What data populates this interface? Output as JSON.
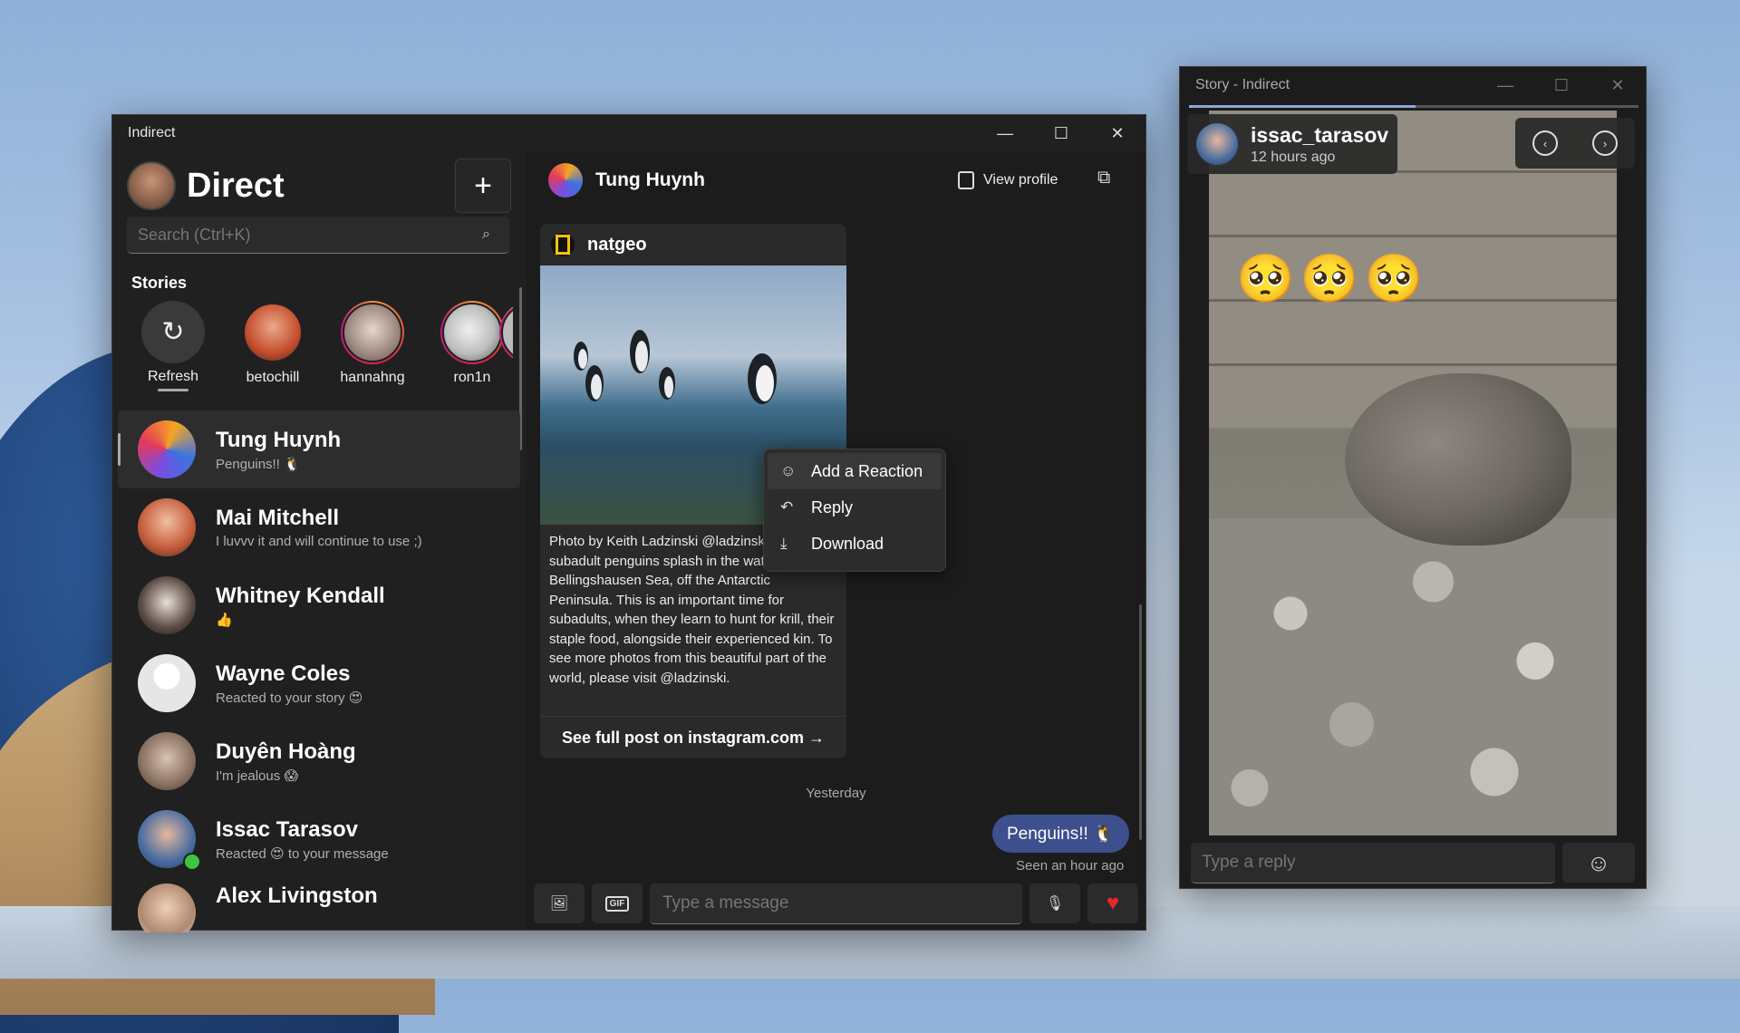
{
  "main_window": {
    "title": "Indirect",
    "minimize": "—",
    "maximize": "☐",
    "close": "✕"
  },
  "sidebar": {
    "title": "Direct",
    "new_button": "+",
    "search_placeholder": "Search (Ctrl+K)",
    "stories_label": "Stories",
    "stories": [
      {
        "name": "Refresh"
      },
      {
        "name": "betochill"
      },
      {
        "name": "hannahng"
      },
      {
        "name": "ron1n"
      }
    ],
    "conversations": [
      {
        "name": "Tung Huynh",
        "preview": "Penguins!! 🐧"
      },
      {
        "name": "Mai Mitchell",
        "preview": "I luvvv it and will continue to use ;)"
      },
      {
        "name": "Whitney Kendall",
        "preview": "👍"
      },
      {
        "name": "Wayne Coles",
        "preview": "Reacted to your story 😍"
      },
      {
        "name": "Duyên Hoàng",
        "preview": "I'm jealous 😱"
      },
      {
        "name": "Issac Tarasov",
        "preview": "Reacted 😍 to your message"
      },
      {
        "name": "Alex Livingston",
        "preview": ""
      }
    ]
  },
  "chat": {
    "contact_name": "Tung Huynh",
    "view_profile": "View profile",
    "post": {
      "account": "natgeo",
      "caption": "Photo by Keith Ladzinski @ladzinski Adult and subadult penguins splash in the waters of the Bellingshausen Sea, off the Antarctic Peninsula. This is an important time for subadults, when they learn to hunt for krill, their staple food, alongside their experienced kin. To see more photos from this beautiful part of the world, please visit @ladzinski.",
      "link": "See full post on instagram.com →"
    },
    "context_menu": [
      {
        "label": "Add a Reaction",
        "icon": "☺"
      },
      {
        "label": "Reply",
        "icon": "↶"
      },
      {
        "label": "Download",
        "icon": "⤓"
      }
    ],
    "day_label": "Yesterday",
    "my_message": "Penguins!! 🐧",
    "seen_status": "Seen an hour ago",
    "composer": {
      "placeholder": "Type a message",
      "gif_label": "GIF"
    }
  },
  "story_window": {
    "title": "Story - Indirect",
    "username": "issac_tarasov",
    "time": "12 hours ago",
    "emojis": "🥺🥺🥺",
    "reply_placeholder": "Type a reply"
  },
  "colors": {
    "accent_bubble": "#3d4f8c",
    "heart": "#e8262c",
    "online": "#3ec43e"
  }
}
